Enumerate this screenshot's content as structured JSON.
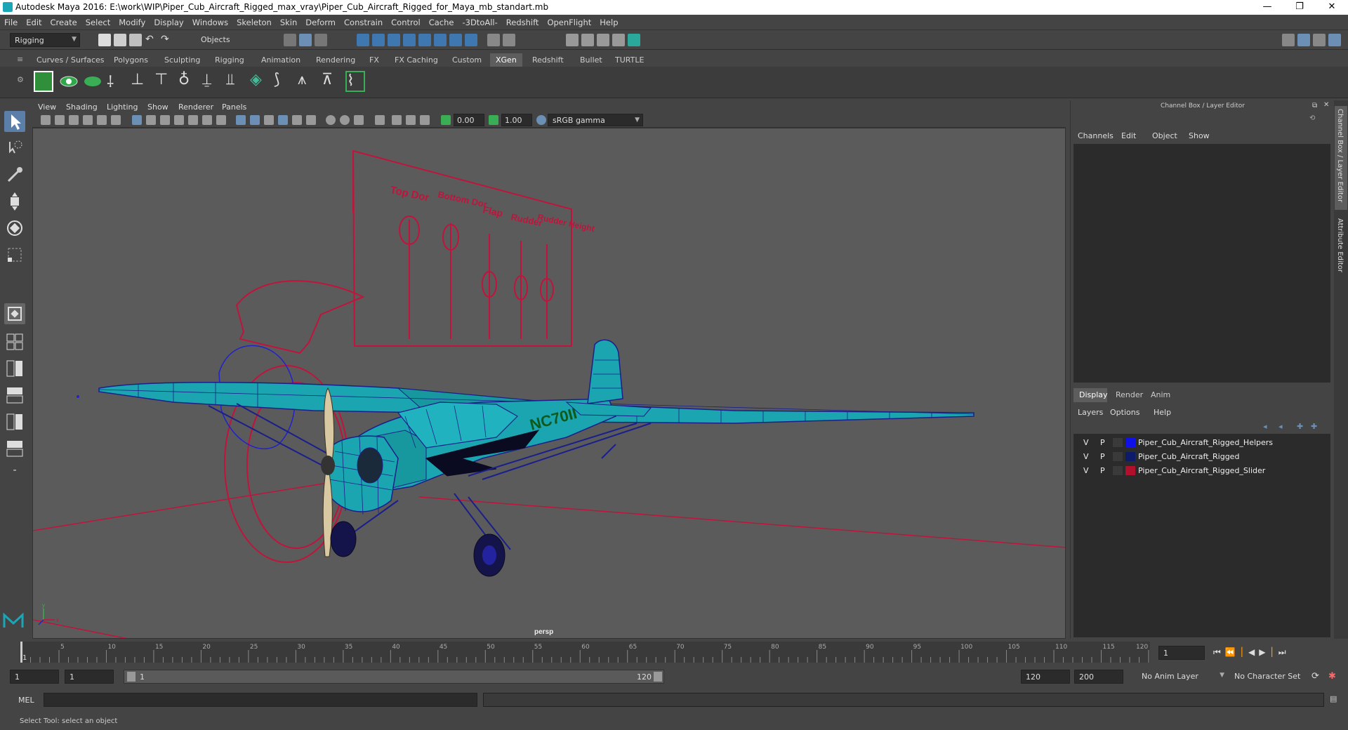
{
  "window": {
    "title": "Autodesk Maya 2016: E:\\work\\WIP\\Piper_Cub_Aircraft_Rigged_max_vray\\Piper_Cub_Aircraft_Rigged_for_Maya_mb_standart.mb",
    "minimize": "—",
    "restore": "❐",
    "close": "✕"
  },
  "menu": [
    "File",
    "Edit",
    "Create",
    "Select",
    "Modify",
    "Display",
    "Windows",
    "Skeleton",
    "Skin",
    "Deform",
    "Constrain",
    "Control",
    "Cache",
    "-3DtoAll-",
    "Redshift",
    "OpenFlight",
    "Help"
  ],
  "status": {
    "mode": "Rigging",
    "select_mode": "Objects"
  },
  "shelf_tabs": [
    "Curves / Surfaces",
    "Polygons",
    "Sculpting",
    "Rigging",
    "Animation",
    "Rendering",
    "FX",
    "FX Caching",
    "Custom",
    "XGen",
    "Redshift",
    "Bullet",
    "TURTLE"
  ],
  "shelf_active": "XGen",
  "panel_menu": [
    "View",
    "Shading",
    "Lighting",
    "Show",
    "Renderer",
    "Panels"
  ],
  "panel_toolbar": {
    "exposure": "0.00",
    "gamma": "1.00",
    "color_space": "sRGB gamma"
  },
  "viewport": {
    "camera_label": "persp",
    "slider_labels": [
      "Top Dor",
      "Bottom\nDor",
      "Flap",
      "Rudder",
      "Rudder\nHeight"
    ],
    "tail_text": "NC70II",
    "axis_x": "x",
    "axis_y": "y"
  },
  "channel_box": {
    "title": "Channel Box / Layer Editor",
    "menu": [
      "Channels",
      "Edit",
      "Object",
      "Show"
    ]
  },
  "layer_editor": {
    "tabs": [
      "Display",
      "Render",
      "Anim"
    ],
    "active_tab": "Display",
    "menu": [
      "Layers",
      "Options",
      "Help"
    ],
    "layers": [
      {
        "v": "V",
        "p": "P",
        "name": "Piper_Cub_Aircraft_Rigged_Helpers",
        "color": "#1010e8"
      },
      {
        "v": "V",
        "p": "P",
        "name": "Piper_Cub_Aircraft_Rigged",
        "color": "#0c1c6a"
      },
      {
        "v": "V",
        "p": "P",
        "name": "Piper_Cub_Aircraft_Rigged_Slider",
        "color": "#b0102c"
      }
    ]
  },
  "side_tabs": [
    "Channel Box / Layer Editor",
    "Attribute Editor"
  ],
  "timeline": {
    "ticks": [
      "5",
      "10",
      "15",
      "20",
      "25",
      "30",
      "35",
      "40",
      "45",
      "50",
      "55",
      "60",
      "65",
      "70",
      "75",
      "80",
      "85",
      "90",
      "95",
      "100",
      "105",
      "110",
      "115",
      "120"
    ],
    "start_tick": "1",
    "current_frame": "1"
  },
  "range": {
    "start": "1",
    "start2": "1",
    "slider_start": "1",
    "slider_end": "120",
    "end": "120",
    "end2": "200",
    "anim_layer": "No Anim Layer",
    "char_set": "No Character Set"
  },
  "command": {
    "label": "MEL"
  },
  "help": {
    "text": "Select Tool: select an object"
  },
  "colors": {
    "accent": "#5d5d5d",
    "wire_red": "#c0143c",
    "mesh_cyan": "#1aa5b0",
    "mesh_blue": "#1a1f8a"
  }
}
